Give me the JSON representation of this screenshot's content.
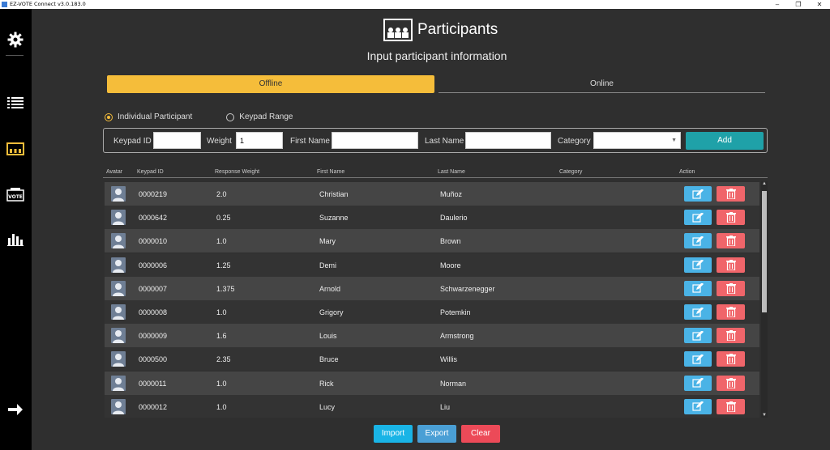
{
  "window": {
    "title": "EZ-VOTE Connect v3.0.183.0",
    "minimize": "–",
    "restore": "❐",
    "close": "✕"
  },
  "sidebar": {
    "items": [
      {
        "name": "settings",
        "icon": "gear-icon"
      },
      {
        "name": "list",
        "icon": "list-icon"
      },
      {
        "name": "participants",
        "icon": "participants-icon",
        "active": true
      },
      {
        "name": "vote",
        "icon": "vote-icon"
      },
      {
        "name": "results",
        "icon": "bar-chart-icon"
      },
      {
        "name": "next",
        "icon": "arrow-right-icon"
      }
    ],
    "active_color": "#f5bd3a"
  },
  "header": {
    "title": "Participants",
    "subtitle": "Input participant information"
  },
  "mode_tabs": {
    "offline": "Offline",
    "online": "Online"
  },
  "radios": {
    "individual": "Individual Participant",
    "range": "Keypad Range"
  },
  "form": {
    "keypad_label": "Keypad ID",
    "keypad_value": "",
    "weight_label": "Weight",
    "weight_value": "1",
    "first_label": "First Name",
    "first_value": "",
    "last_label": "Last Name",
    "last_value": "",
    "category_label": "Category",
    "add_label": "Add"
  },
  "columns": {
    "avatar": "Avatar",
    "keypad": "Keypad ID",
    "weight": "Response Weight",
    "first": "First Name",
    "last": "Last Name",
    "category": "Category",
    "action": "Action"
  },
  "rows": [
    {
      "keypad": "0000219",
      "weight": "2.0",
      "first": "Christian",
      "last": "Muñoz",
      "category": ""
    },
    {
      "keypad": "0000642",
      "weight": "0.25",
      "first": "Suzanne",
      "last": "Daulerio",
      "category": ""
    },
    {
      "keypad": "0000010",
      "weight": "1.0",
      "first": "Mary",
      "last": "Brown",
      "category": ""
    },
    {
      "keypad": "0000006",
      "weight": "1.25",
      "first": "Demi",
      "last": "Moore",
      "category": ""
    },
    {
      "keypad": "0000007",
      "weight": "1.375",
      "first": "Arnold",
      "last": "Schwarzenegger",
      "category": ""
    },
    {
      "keypad": "0000008",
      "weight": "1.0",
      "first": "Grigory",
      "last": "Potemkin",
      "category": ""
    },
    {
      "keypad": "0000009",
      "weight": "1.6",
      "first": "Louis",
      "last": "Armstrong",
      "category": ""
    },
    {
      "keypad": "0000500",
      "weight": "2.35",
      "first": "Bruce",
      "last": "Willis",
      "category": ""
    },
    {
      "keypad": "0000011",
      "weight": "1.0",
      "first": "Rick",
      "last": "Norman",
      "category": ""
    },
    {
      "keypad": "0000012",
      "weight": "1.0",
      "first": "Lucy",
      "last": "Liu",
      "category": ""
    }
  ],
  "bottom": {
    "import": "Import",
    "export": "Export",
    "clear": "Clear"
  },
  "colors": {
    "offline_tab": "#f5bd3a",
    "add": "#1fa1a8",
    "edit": "#4ab3e6",
    "delete": "#f0656a",
    "import": "#19b4e6",
    "export": "#4a9fd5",
    "clear": "#ec4a58"
  }
}
